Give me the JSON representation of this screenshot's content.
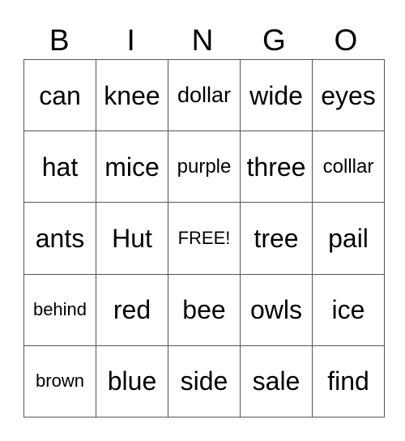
{
  "header": {
    "letters": [
      "B",
      "I",
      "N",
      "G",
      "O"
    ]
  },
  "card": {
    "rows": [
      [
        {
          "word": "can",
          "size": "lg"
        },
        {
          "word": "knee",
          "size": "lg"
        },
        {
          "word": "dollar",
          "size": "md"
        },
        {
          "word": "wide",
          "size": "lg"
        },
        {
          "word": "eyes",
          "size": "lg"
        }
      ],
      [
        {
          "word": "hat",
          "size": "lg"
        },
        {
          "word": "mice",
          "size": "lg"
        },
        {
          "word": "purple",
          "size": "sm"
        },
        {
          "word": "three",
          "size": "lg"
        },
        {
          "word": "colllar",
          "size": "sm"
        }
      ],
      [
        {
          "word": "ants",
          "size": "lg"
        },
        {
          "word": "Hut",
          "size": "lg"
        },
        {
          "word": "FREE!",
          "size": "xs"
        },
        {
          "word": "tree",
          "size": "lg"
        },
        {
          "word": "pail",
          "size": "lg"
        }
      ],
      [
        {
          "word": "behind",
          "size": "xs"
        },
        {
          "word": "red",
          "size": "lg"
        },
        {
          "word": "bee",
          "size": "lg"
        },
        {
          "word": "owls",
          "size": "lg"
        },
        {
          "word": "ice",
          "size": "lg"
        }
      ],
      [
        {
          "word": "brown",
          "size": "xs"
        },
        {
          "word": "blue",
          "size": "lg"
        },
        {
          "word": "side",
          "size": "lg"
        },
        {
          "word": "sale",
          "size": "lg"
        },
        {
          "word": "find",
          "size": "lg"
        }
      ]
    ]
  }
}
